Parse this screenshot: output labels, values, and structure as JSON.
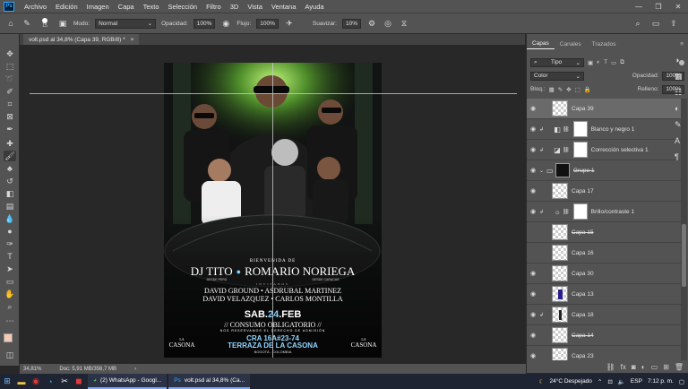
{
  "app": {
    "menus": [
      "Archivo",
      "Edición",
      "Imagen",
      "Capa",
      "Texto",
      "Selección",
      "Filtro",
      "3D",
      "Vista",
      "Ventana",
      "Ayuda"
    ],
    "window_controls": [
      "—",
      "❐",
      "✕"
    ]
  },
  "options": {
    "brush_size": "15",
    "mode_label": "Modo:",
    "mode_value": "Normal",
    "opacity_label": "Opacidad:",
    "opacity_value": "100%",
    "flow_label": "Flujo:",
    "flow_value": "100%",
    "smooth_label": "Suavizar:",
    "smooth_value": "10%"
  },
  "document_tab": {
    "title": "volt.psd al 34,8% (Capa 39, RGB/8) *",
    "close": "×"
  },
  "status": {
    "zoom": "34,81%",
    "doc": "Doc: 5,91 MB/356,7 MB",
    "arrow": "›"
  },
  "poster": {
    "welcome": "BIENVENIDA DE",
    "dj1": "DJ TITO",
    "dj2": "ROMARIO NORIEGA",
    "sub1": "DESDE PERÚ",
    "sub2": "DESDE CARACAS",
    "guests_header": "INVITADOS",
    "guests_line1": "DAVID GROUND • ASDRUBAL MARTINEZ",
    "guests_line2": "DAVID VELAZQUEZ • CARLOS MONTILLA",
    "date_pre": "SAB.",
    "date_day": "24",
    "date_post": ".FEB",
    "consumo": "// CONSUMO OBLIGATORIO //",
    "derecho": "NOS RESERVAMOS EL DERECHO DE ADMISIÓN",
    "address": "CRA 16A#23-74",
    "venue": "TERRAZA DE LA CASONA",
    "city": "BOGOTÁ - COLOMBIA",
    "logo_small": "LA",
    "logo_big": "CASONA"
  },
  "panel": {
    "tabs": [
      "Capas",
      "Canales",
      "Trazados"
    ],
    "filter_kind": "Tipo",
    "blend_mode": "Color",
    "opacity_label": "Opacidad:",
    "opacity_value": "100%",
    "lock_label": "Bloq.:",
    "fill_label": "Relleno:",
    "fill_value": "100%",
    "layers": [
      {
        "name": "Capa 39",
        "type": "pixel",
        "selected": true
      },
      {
        "name": "Blanco y negro 1",
        "type": "adjustment"
      },
      {
        "name": "Corrección selectiva 1",
        "type": "adjustment"
      },
      {
        "name": "Grupo 1",
        "type": "group"
      },
      {
        "name": "Capa 17",
        "type": "pixel"
      },
      {
        "name": "Brillo/contraste 1",
        "type": "adjustment"
      },
      {
        "name": "Capa 15",
        "type": "pixel",
        "hidden": true
      },
      {
        "name": "Capa 16",
        "type": "pixel",
        "hidden": true
      },
      {
        "name": "Capa 30",
        "type": "pixel"
      },
      {
        "name": "Capa 13",
        "type": "pixel"
      },
      {
        "name": "Capa 18",
        "type": "pixel"
      },
      {
        "name": "Capa 14",
        "type": "pixel",
        "hidden": true
      },
      {
        "name": "Capa 23",
        "type": "pixel"
      }
    ]
  },
  "taskbar": {
    "apps": [
      {
        "name": "(2) WhatsApp - Googl..."
      },
      {
        "name": "volt.psd al 34,8% (Ca..."
      }
    ],
    "weather": "24°C  Despejado",
    "lang": "ESP",
    "time": "7:12 p. m."
  },
  "colors": {
    "accent": "#31a8ff",
    "ui_bg": "#535353",
    "canvas_bg": "#282828",
    "poster_date_accent": "#7fd0ff"
  }
}
